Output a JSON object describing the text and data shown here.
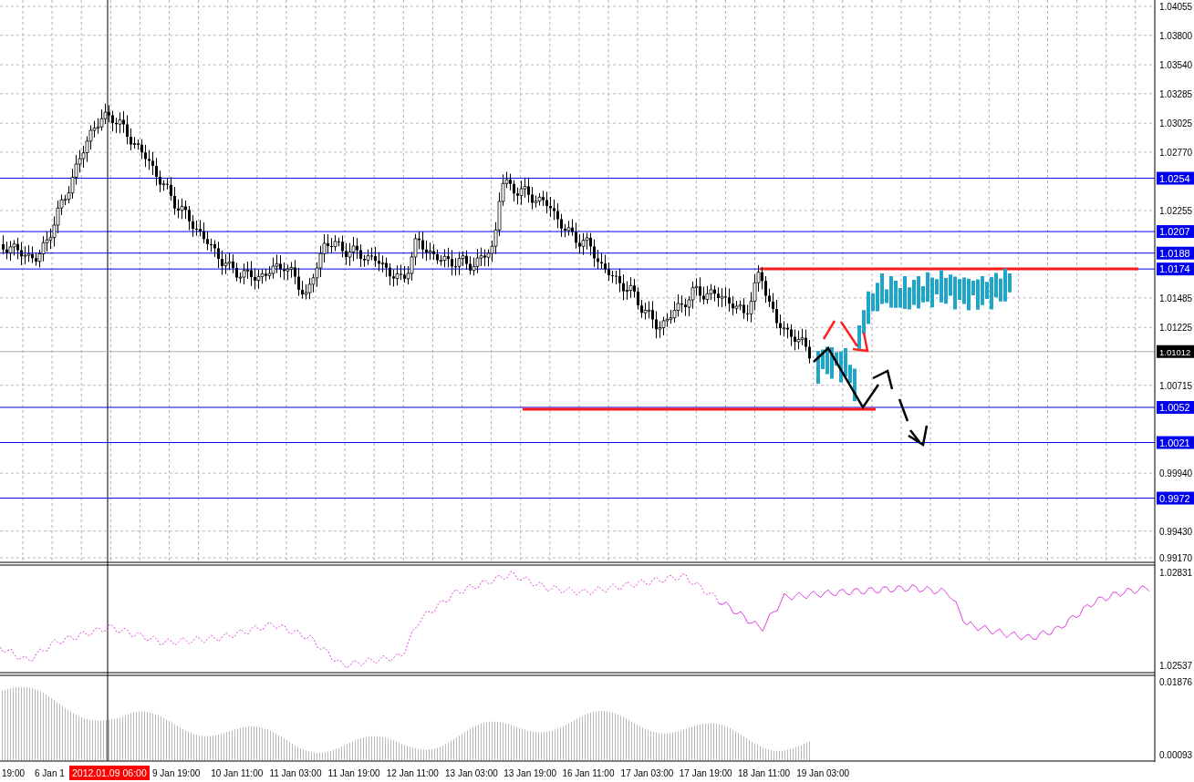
{
  "price_axis": {
    "ticks": [
      "1.04055",
      "1.03800",
      "1.03540",
      "1.03285",
      "1.03025",
      "1.02770",
      "1.02255",
      "1.01485",
      "1.01225",
      "1.00715",
      "0.99940",
      "0.99430",
      "0.99170"
    ]
  },
  "levels": [
    {
      "label": "1.0254",
      "kind": "level"
    },
    {
      "label": "1.0207",
      "kind": "level"
    },
    {
      "label": "1.0188",
      "kind": "level"
    },
    {
      "label": "1.0174",
      "kind": "level"
    },
    {
      "label": "1.01012",
      "kind": "current"
    },
    {
      "label": "1.0052",
      "kind": "level"
    },
    {
      "label": "1.0021",
      "kind": "level"
    },
    {
      "label": "0.9972",
      "kind": "level"
    }
  ],
  "indicator_1": {
    "axis": [
      "1.02831",
      "1.02537"
    ]
  },
  "indicator_2": {
    "axis": [
      "0.01876",
      "0.00093"
    ]
  },
  "time_axis": {
    "labels": [
      "19:00",
      "6 Jan 1",
      "9 Jan 19:00",
      "10 Jan 11:00",
      "11 Jan 03:00",
      "11 Jan 19:00",
      "12 Jan 11:00",
      "13 Jan 03:00",
      "13 Jan 19:00",
      "16 Jan 11:00",
      "17 Jan 03:00",
      "17 Jan 19:00",
      "18 Jan 11:00",
      "19 Jan 03:00"
    ],
    "cursor_label": "2012.01.09 06:00"
  }
}
